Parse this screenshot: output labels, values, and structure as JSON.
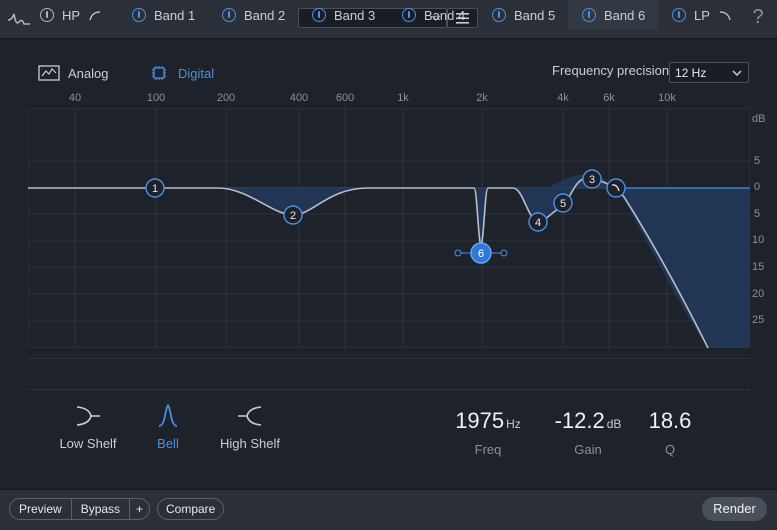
{
  "toolbar": {
    "preset_value": "",
    "help_label": "?",
    "icons": [
      "eq-logo-icon",
      "chevron-down-icon",
      "menu-icon"
    ]
  },
  "mode": {
    "analog_label": "Analog",
    "digital_label": "Digital",
    "selected": "Digital",
    "accent_color": "#4a90e2"
  },
  "precision": {
    "label": "Frequency precision",
    "value": "12 Hz"
  },
  "graph": {
    "freq_ticks": [
      "40",
      "100",
      "200",
      "400",
      "600",
      "1k",
      "2k",
      "4k",
      "6k",
      "10k"
    ],
    "db_unit": "dB",
    "db_ticks": [
      "5",
      "0",
      "5",
      "10",
      "15",
      "20",
      "25"
    ],
    "nodes": [
      "1",
      "2",
      "3",
      "4",
      "5",
      "6"
    ],
    "selected_node": "6"
  },
  "bands": [
    {
      "label": "HP",
      "active": false
    },
    {
      "label": "Band 1",
      "active": false
    },
    {
      "label": "Band 2",
      "active": false
    },
    {
      "label": "Band 3",
      "active": false
    },
    {
      "label": "Band 4",
      "active": false
    },
    {
      "label": "Band 5",
      "active": false
    },
    {
      "label": "Band 6",
      "active": true
    },
    {
      "label": "LP",
      "active": false
    }
  ],
  "shapes": {
    "low_shelf": "Low Shelf",
    "bell": "Bell",
    "high_shelf": "High Shelf",
    "selected": "Bell"
  },
  "params": {
    "freq": {
      "value": "1975",
      "unit": "Hz",
      "label": "Freq"
    },
    "gain": {
      "value": "-12.2",
      "unit": "dB",
      "label": "Gain"
    },
    "q": {
      "value": "18.6",
      "unit": "",
      "label": "Q"
    }
  },
  "footer": {
    "preview_label": "Preview",
    "bypass_label": "Bypass",
    "plus_label": "+",
    "compare_label": "Compare",
    "render_label": "Render"
  }
}
